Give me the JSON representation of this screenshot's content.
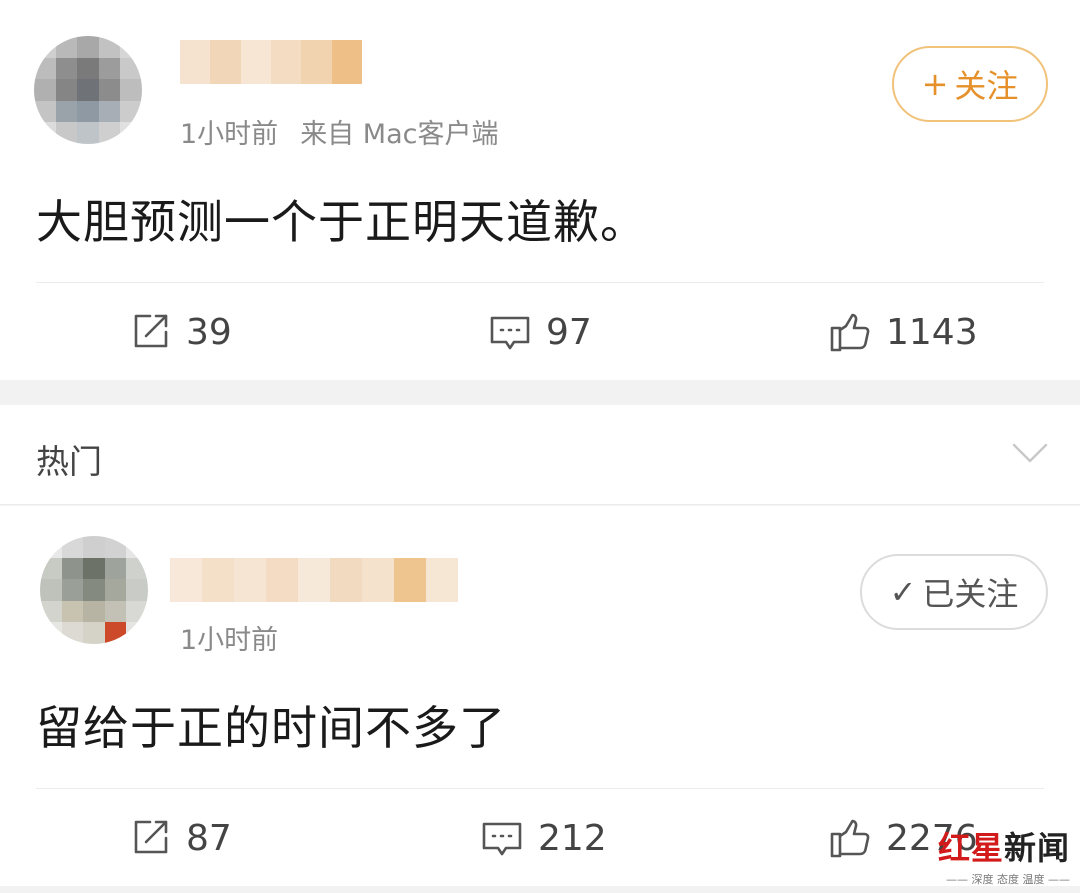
{
  "posts": [
    {
      "timestamp": "1小时前",
      "source": "来自 Mac客户端",
      "follow_mark": "+",
      "follow_label": "关注",
      "text": "大胆预测一个于正明天道歉。",
      "reposts": "39",
      "comments": "97",
      "likes": "1143"
    },
    {
      "timestamp": "1小时前",
      "source": "",
      "follow_mark": "✓",
      "follow_label": "已关注",
      "text": "留给于正的时间不多了",
      "reposts": "87",
      "comments": "212",
      "likes": "2276"
    }
  ],
  "section": {
    "label": "热门"
  },
  "watermark": {
    "title_red": "红星",
    "title_black": "新闻",
    "subtitle": "—— 深度 态度 温度 ——"
  },
  "colors": {
    "accent_orange": "#e5902a",
    "follow_border": "#f0c27a",
    "watermark_red": "#d21a1a"
  },
  "icons": [
    "repost-icon",
    "comment-icon",
    "like-icon",
    "chevron-down-icon"
  ]
}
